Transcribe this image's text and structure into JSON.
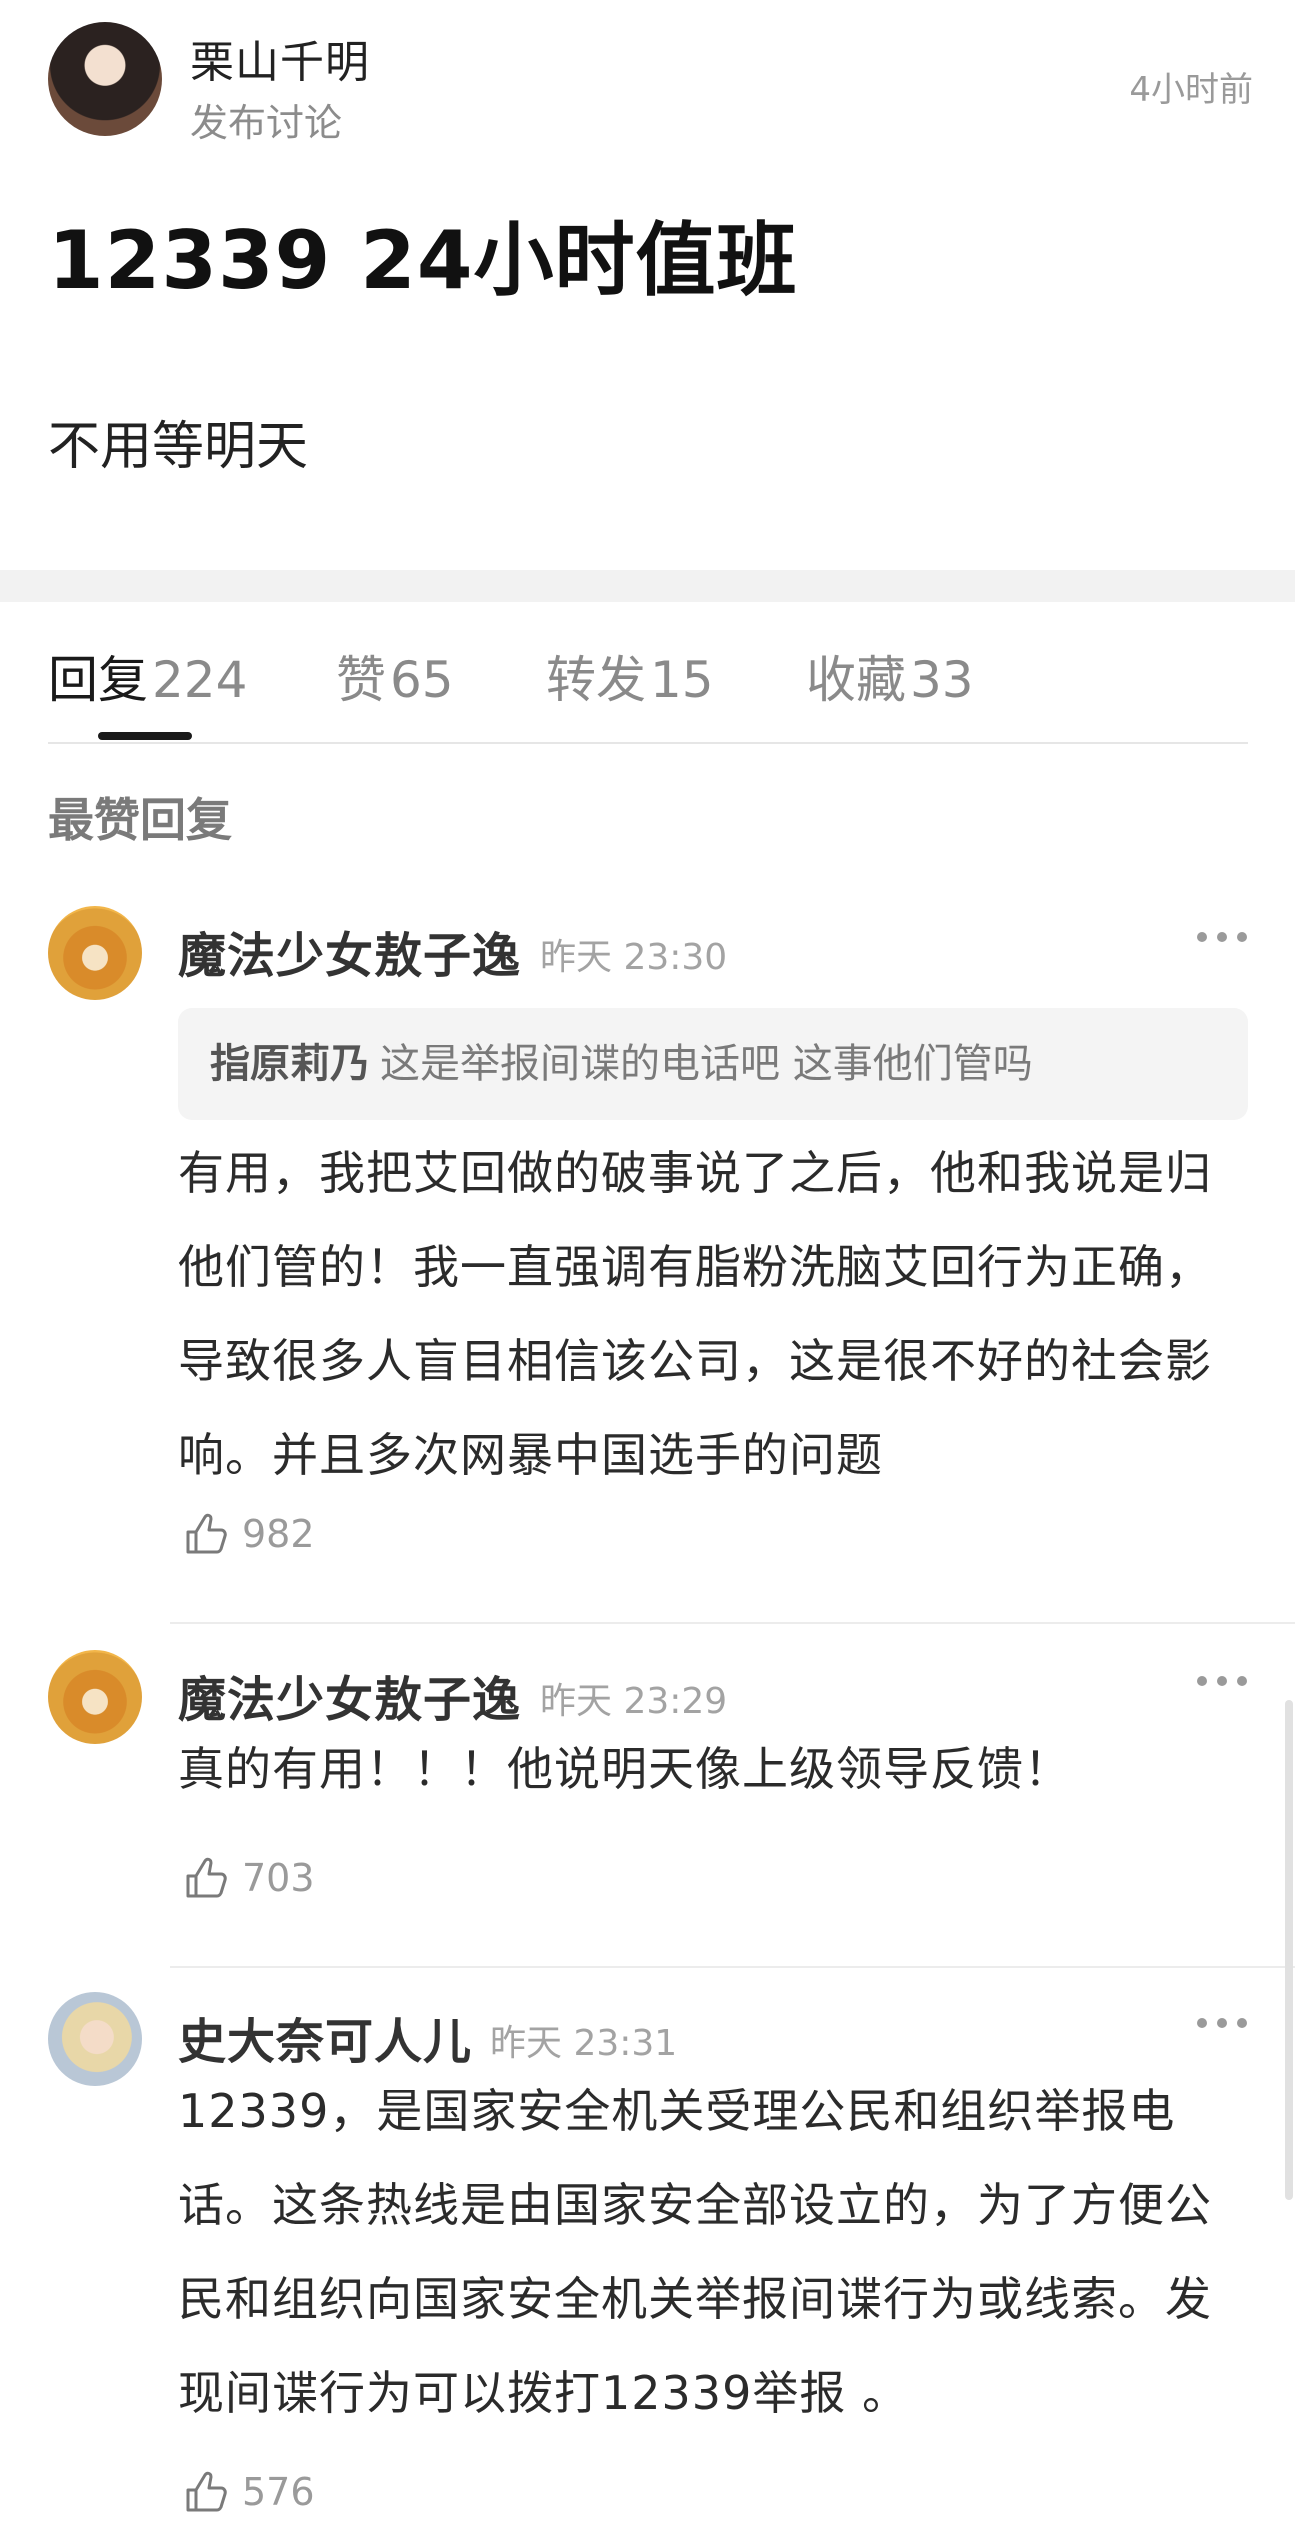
{
  "post": {
    "author_name": "栗山千明",
    "action": "发布讨论",
    "time": "4小时前",
    "title": "12339 24小时值班",
    "body": "不用等明天"
  },
  "tabs": [
    {
      "label": "回复",
      "count": "224",
      "active": true
    },
    {
      "label": "赞",
      "count": "65",
      "active": false
    },
    {
      "label": "转发",
      "count": "15",
      "active": false
    },
    {
      "label": "收藏",
      "count": "33",
      "active": false
    }
  ],
  "section_label": "最赞回复",
  "comments": [
    {
      "name": "魔法少女敖子逸",
      "time": "昨天 23:30",
      "quote": {
        "name": "指原莉乃",
        "text": "这是举报间谍的电话吧 这事他们管吗"
      },
      "text": "有用，我把艾回做的破事说了之后，他和我说是归他们管的！我一直强调有脂粉洗脑艾回行为正确，导致很多人盲目相信该公司，这是很不好的社会影响。并且多次网暴中国选手的问题",
      "likes": "982",
      "avatar": "shiba-dog-avatar"
    },
    {
      "name": "魔法少女敖子逸",
      "time": "昨天 23:29",
      "text": "真的有用！！！他说明天像上级领导反馈！",
      "likes": "703",
      "avatar": "shiba-dog-avatar"
    },
    {
      "name": "史大奈可人儿",
      "time": "昨天 23:31",
      "text": "12339，是国家安全机关受理公民和组织举报电话。这条热线是由国家安全部设立的，为了方便公民和组织向国家安全机关举报间谍行为或线索。发现间谍行为可以拨打12339举报 。",
      "likes": "576",
      "avatar": "blonde-person-avatar"
    }
  ],
  "colors": {
    "text_primary": "#1f1f1f",
    "text_secondary": "#8c8c8c",
    "divider": "#f2f2f2",
    "quote_bg": "#f4f4f4",
    "tab_indicator": "#1a1a1a"
  }
}
